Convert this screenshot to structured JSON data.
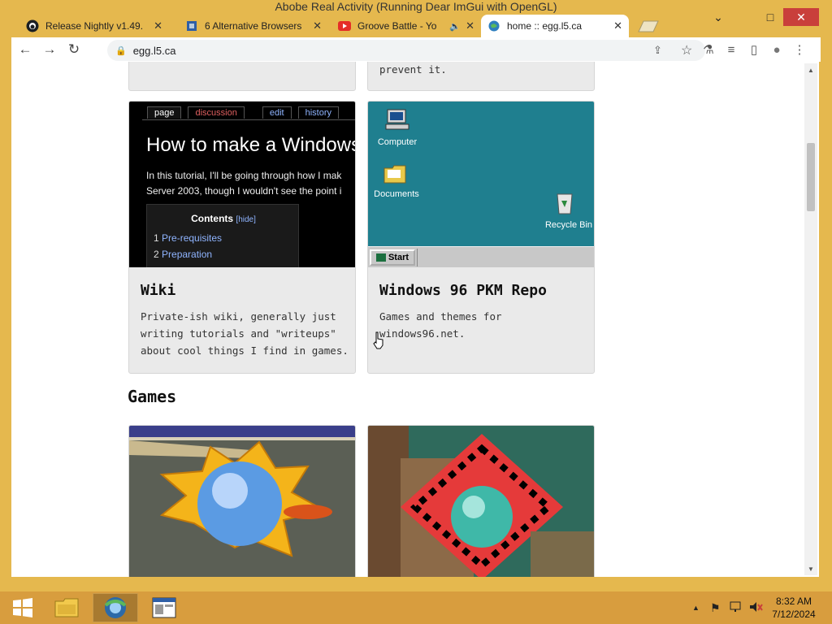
{
  "window": {
    "title": "Abobe Real Activity (Running Dear ImGui with OpenGL)",
    "min_icon": "⌄",
    "restore_icon": "▭",
    "max_icon": "□",
    "close_icon": "✕"
  },
  "tabs": [
    {
      "title": "Release Nightly v1.49.",
      "icon": "github-icon",
      "close": "✕"
    },
    {
      "title": "6 Alternative Browsers",
      "icon": "page-icon",
      "close": "✕"
    },
    {
      "title": "Groove Battle - Yo",
      "icon": "youtube-icon",
      "close": "✕",
      "audio": "🔈"
    },
    {
      "title": "home :: egg.l5.ca",
      "icon": "globe-icon",
      "close": "✕"
    }
  ],
  "toolbar": {
    "back": "←",
    "forward": "→",
    "reload": "↻",
    "lock": "🔒",
    "url": "egg.l5.ca",
    "share": "⇪",
    "star": "☆",
    "labs": "⚗",
    "media": "≡",
    "sidepanel": "▯",
    "profile": "●",
    "menu": "⋮"
  },
  "page": {
    "prev_card_text": "prevent it.",
    "cards": [
      {
        "title": "Wiki",
        "desc": "Private-ish wiki, generally just writing tutorials and \"writeups\" about cool things I find in games."
      },
      {
        "title": "Windows 96 PKM Repo",
        "desc": "Games and themes for windows96.net."
      }
    ],
    "section": "Games",
    "wiki_shot": {
      "tabs": [
        "page",
        "discussion",
        "edit",
        "history"
      ],
      "heading": "How to make a Windows",
      "intro1": "In this tutorial, I'll be going through how I mak",
      "intro2": "Server 2003, though I wouldn't see the point i",
      "toc_title": "Contents",
      "toc_hide": "[hide]",
      "toc": [
        {
          "n": "1",
          "t": "Pre-requisites"
        },
        {
          "n": "2",
          "t": "Preparation"
        }
      ]
    },
    "win96_shot": {
      "icons": [
        "Computer",
        "Documents",
        "Recycle Bin"
      ],
      "start": "Start"
    }
  },
  "taskbar": {
    "time": "8:32 AM",
    "date": "7/12/2024",
    "tray_up": "▲",
    "flag": "⚑"
  },
  "colors": {
    "frame": "#e5b84e",
    "taskbar": "#d89d3e",
    "desktop": "#f4a0a8",
    "accent_close": "#c93f3b",
    "win96_desktop": "#1f7f8f"
  }
}
